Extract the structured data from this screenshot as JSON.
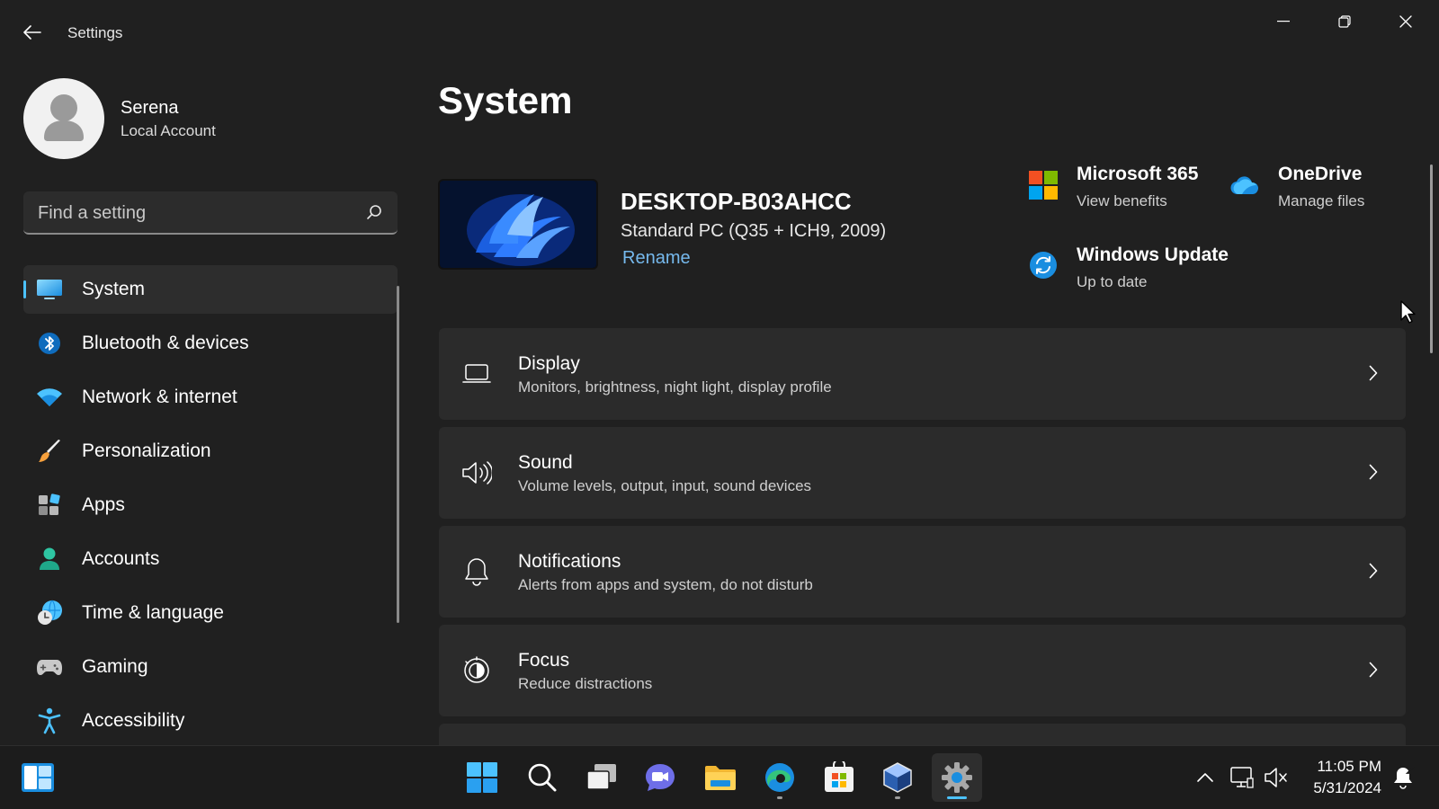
{
  "window": {
    "title": "Settings"
  },
  "profile": {
    "name": "Serena",
    "account_type": "Local Account"
  },
  "search": {
    "placeholder": "Find a setting"
  },
  "nav": {
    "items": [
      {
        "label": "System",
        "icon": "monitor-icon",
        "active": true
      },
      {
        "label": "Bluetooth & devices",
        "icon": "bluetooth-icon"
      },
      {
        "label": "Network & internet",
        "icon": "wifi-icon"
      },
      {
        "label": "Personalization",
        "icon": "paintbrush-icon"
      },
      {
        "label": "Apps",
        "icon": "apps-icon"
      },
      {
        "label": "Accounts",
        "icon": "person-icon"
      },
      {
        "label": "Time & language",
        "icon": "clock-globe-icon"
      },
      {
        "label": "Gaming",
        "icon": "gamepad-icon"
      },
      {
        "label": "Accessibility",
        "icon": "accessibility-icon"
      }
    ]
  },
  "main": {
    "title": "System",
    "device": {
      "name": "DESKTOP-B03AHCC",
      "model": "Standard PC (Q35 + ICH9, 2009)",
      "rename_label": "Rename"
    },
    "quick_links": [
      {
        "title": "Microsoft 365",
        "subtitle": "View benefits",
        "icon": "microsoft-logo-icon"
      },
      {
        "title": "OneDrive",
        "subtitle": "Manage files",
        "icon": "cloud-icon"
      },
      {
        "title": "Windows Update",
        "subtitle": "Up to date",
        "icon": "update-icon"
      }
    ],
    "cards": [
      {
        "title": "Display",
        "subtitle": "Monitors, brightness, night light, display profile",
        "icon": "laptop-icon"
      },
      {
        "title": "Sound",
        "subtitle": "Volume levels, output, input, sound devices",
        "icon": "speaker-icon"
      },
      {
        "title": "Notifications",
        "subtitle": "Alerts from apps and system, do not disturb",
        "icon": "bell-icon"
      },
      {
        "title": "Focus",
        "subtitle": "Reduce distractions",
        "icon": "focus-icon"
      }
    ]
  },
  "taskbar": {
    "time": "11:05 PM",
    "date": "5/31/2024"
  },
  "colors": {
    "accent": "#4cc2ff",
    "link": "#76b9ed",
    "background": "#202020",
    "card": "#2b2b2b"
  }
}
